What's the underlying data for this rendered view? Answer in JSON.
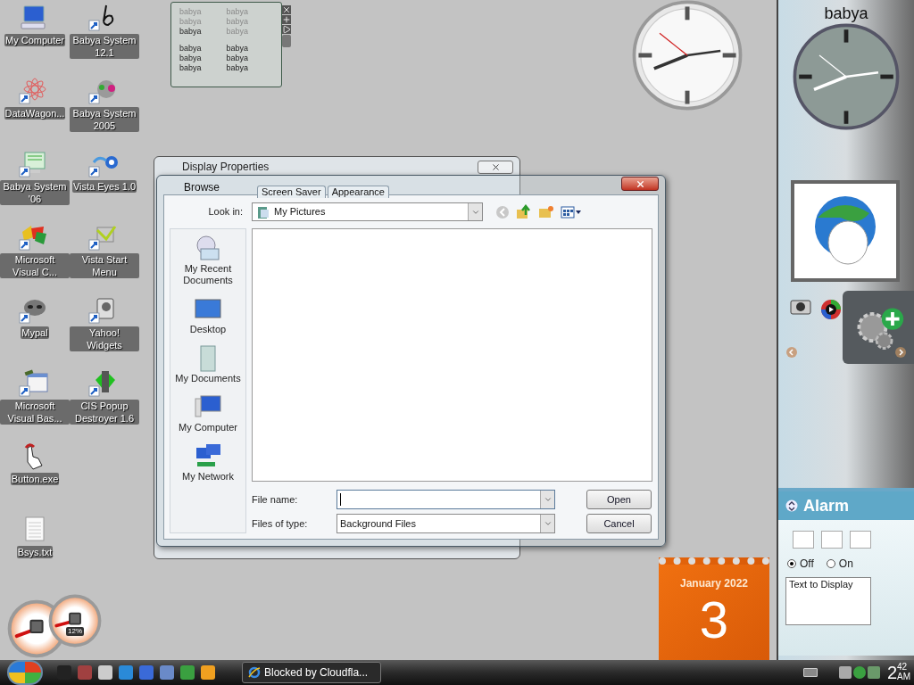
{
  "desktop_icons": {
    "column_1": [
      {
        "label": "My Computer",
        "shortcut": false
      },
      {
        "label": "DataWagon...",
        "shortcut": true
      },
      {
        "label": "Babya System '06",
        "shortcut": true
      },
      {
        "label": "Microsoft Visual C...",
        "shortcut": true
      },
      {
        "label": "Mypal",
        "shortcut": true
      },
      {
        "label": "Microsoft Visual Bas...",
        "shortcut": true
      },
      {
        "label": "Button.exe",
        "shortcut": false
      },
      {
        "label": "Bsys.txt",
        "shortcut": false
      }
    ],
    "column_2": [
      {
        "label": "Babya System 12.1",
        "shortcut": true
      },
      {
        "label": "Babya System 2005",
        "shortcut": true
      },
      {
        "label": "Vista Eyes 1.0",
        "shortcut": true
      },
      {
        "label": "Vista Start Menu",
        "shortcut": true
      },
      {
        "label": "Yahoo! Widgets",
        "shortcut": true
      },
      {
        "label": "CIS Popup Destroyer 1.6",
        "shortcut": true
      }
    ]
  },
  "feed_gadget": {
    "groups": [
      [
        {
          "text": "babya",
          "read": true
        },
        {
          "text": "babya",
          "read": true
        },
        {
          "text": "babya",
          "read": true
        },
        {
          "text": "babya",
          "read": true
        },
        {
          "text": "babya",
          "read": false
        },
        {
          "text": "babya",
          "read": true
        }
      ],
      [
        {
          "text": "babya",
          "read": false
        },
        {
          "text": "babya",
          "read": false
        },
        {
          "text": "babya",
          "read": false
        },
        {
          "text": "babya",
          "read": false
        },
        {
          "text": "babya",
          "read": false
        },
        {
          "text": "babya",
          "read": false
        }
      ]
    ]
  },
  "display_properties": {
    "title": "Display Properties",
    "tabs": [
      {
        "label": "Screen Saver",
        "selected": false
      },
      {
        "label": "Appearance",
        "selected": false
      }
    ]
  },
  "browse_dialog": {
    "title": "Browse",
    "look_in": {
      "label": "Look in:",
      "value": "My Pictures"
    },
    "places": [
      {
        "label": "My Recent Documents",
        "selected": false
      },
      {
        "label": "Desktop",
        "selected": false
      },
      {
        "label": "My Documents",
        "selected": false
      },
      {
        "label": "My Computer",
        "selected": false
      },
      {
        "label": "My Network",
        "selected": false
      }
    ],
    "file_name": {
      "label": "File name:",
      "focused": true
    },
    "file_type": {
      "label": "Files of type:",
      "value": "Background Files"
    },
    "buttons": [
      "Open",
      "Cancel"
    ]
  },
  "sidebar": {
    "title": "babya",
    "alarm": {
      "title": "Alarm",
      "options": [
        {
          "label": "Off",
          "selected": true
        },
        {
          "label": "On",
          "selected": false
        }
      ],
      "message": "Text to Display"
    }
  },
  "calendar": {
    "month": "January 2022",
    "day": "3"
  },
  "cpu_gauge": {
    "reading": "12%"
  },
  "taskbar": {
    "tasks": [
      {
        "label": "Blocked by Cloudfla...",
        "selected": false
      }
    ],
    "clock": {
      "hour": "2",
      "minute": "42",
      "period": "AM"
    }
  }
}
